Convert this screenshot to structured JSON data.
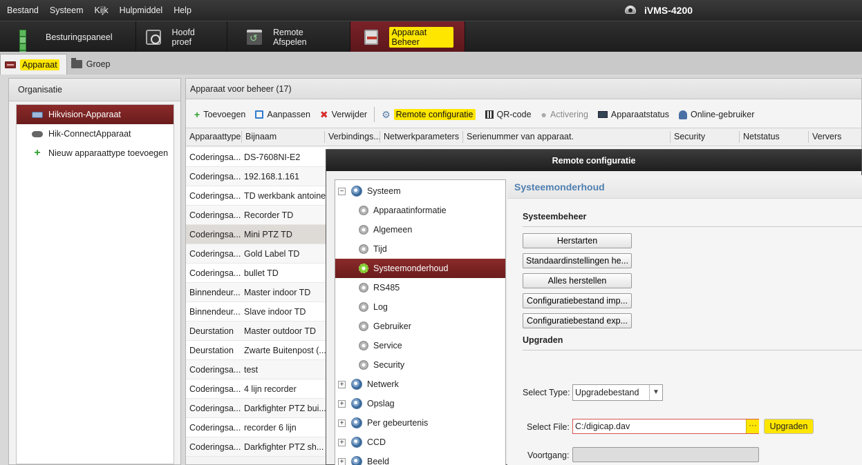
{
  "menubar": {
    "items": [
      "Bestand",
      "Systeem",
      "Kijk",
      "Hulpmiddel",
      "Help"
    ]
  },
  "app": {
    "title": "iVMS-4200"
  },
  "main_tabs": [
    {
      "label": "Besturingspaneel",
      "icon": "control-panel-icon"
    },
    {
      "label": "Hoofd proef",
      "icon": "main-view-icon"
    },
    {
      "label": "Remote Afspelen",
      "icon": "remote-playback-icon"
    },
    {
      "label": "Apparaat Beheer",
      "icon": "device-management-icon",
      "active": true
    }
  ],
  "sub_tabs": [
    {
      "label": "Apparaat",
      "active": true
    },
    {
      "label": "Groep"
    }
  ],
  "organisation": {
    "title": "Organisatie",
    "items": [
      "Hikvision-Apparaat",
      "Hik-ConnectApparaat",
      "Nieuw apparaattype toevoegen"
    ]
  },
  "devices": {
    "title": "Apparaat voor beheer (17)",
    "toolbar": [
      "Toevoegen",
      "Aanpassen",
      "Verwijder",
      "Remote configuratie",
      "QR-code",
      "Activering",
      "Apparaatstatus",
      "Online-gebruiker"
    ],
    "columns": [
      "Apparaattype",
      "Bijnaam",
      "Verbindings...",
      "Netwerkparameters",
      "Serienummer van apparaat.",
      "Security",
      "Netstatus",
      "Ververs"
    ],
    "rows": [
      [
        "Coderingsa...",
        "DS-7608NI-E2"
      ],
      [
        "Coderingsa...",
        "192.168.1.161"
      ],
      [
        "Coderingsa...",
        "TD werkbank antoine"
      ],
      [
        "Coderingsa...",
        "Recorder TD"
      ],
      [
        "Coderingsa...",
        "Mini PTZ TD"
      ],
      [
        "Coderingsa...",
        "Gold Label TD"
      ],
      [
        "Coderingsa...",
        "bullet TD"
      ],
      [
        "Binnendeur...",
        "Master indoor TD"
      ],
      [
        "Binnendeur...",
        "Slave indoor TD"
      ],
      [
        "Deurstation",
        "Master outdoor TD"
      ],
      [
        "Deurstation",
        "Zwarte Buitenpost (..."
      ],
      [
        "Coderingsa...",
        "test"
      ],
      [
        "Coderingsa...",
        "4 lijn recorder"
      ],
      [
        "Coderingsa...",
        "Darkfighter PTZ bui..."
      ],
      [
        "Coderingsa...",
        "recorder 6 lijn"
      ],
      [
        "Coderingsa...",
        "Darkfighter PTZ sh..."
      ]
    ]
  },
  "dialog": {
    "title": "Remote configuratie",
    "tree": [
      {
        "label": "Systeem",
        "level": 0,
        "expand": "−"
      },
      {
        "label": "Apparaatinformatie",
        "level": 1
      },
      {
        "label": "Algemeen",
        "level": 1
      },
      {
        "label": "Tijd",
        "level": 1
      },
      {
        "label": "Systeemonderhoud",
        "level": 1,
        "selected": true
      },
      {
        "label": "RS485",
        "level": 1
      },
      {
        "label": "Log",
        "level": 1
      },
      {
        "label": "Gebruiker",
        "level": 1
      },
      {
        "label": "Service",
        "level": 1
      },
      {
        "label": "Security",
        "level": 1
      },
      {
        "label": "Netwerk",
        "level": 0,
        "expand": "+"
      },
      {
        "label": "Opslag",
        "level": 0,
        "expand": "+"
      },
      {
        "label": "Per gebeurtenis",
        "level": 0,
        "expand": "+"
      },
      {
        "label": "CCD",
        "level": 0,
        "expand": "+"
      },
      {
        "label": "Beeld",
        "level": 0,
        "expand": "+"
      }
    ],
    "content": {
      "title": "Systeemonderhoud",
      "section_management": "Systeembeheer",
      "buttons": [
        "Herstarten",
        "Standaardinstellingen he...",
        "Alles herstellen",
        "Configuratiebestand imp...",
        "Configuratiebestand exp..."
      ],
      "section_upgrade": "Upgraden",
      "select_type_label": "Select Type:",
      "select_type_value": "Upgradebestand",
      "select_file_label": "Select File:",
      "select_file_value": "C:/digicap.dav",
      "browse_label": "···",
      "upgrade_button": "Upgraden",
      "progress_label": "Voortgang:",
      "progress_value": 0
    }
  },
  "colors": {
    "accent": "#7a2228",
    "highlight": "#ffe600",
    "title_blue": "#4f7fb0"
  }
}
